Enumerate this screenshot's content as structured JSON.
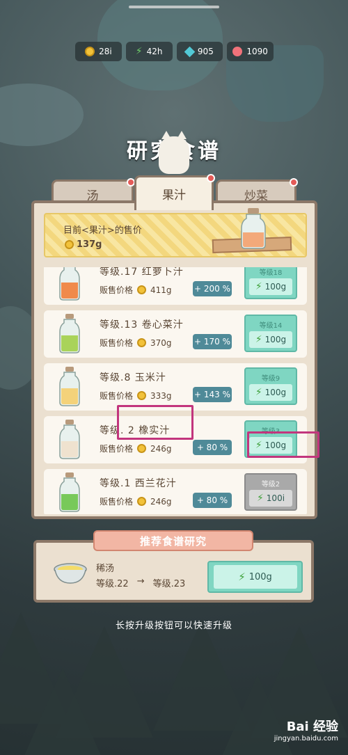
{
  "resources": [
    {
      "icon": "coin-icon",
      "value": "28i"
    },
    {
      "icon": "energy-bolt-icon",
      "value": "42h"
    },
    {
      "icon": "gem-icon",
      "value": "905"
    },
    {
      "icon": "shell-icon",
      "value": "1090"
    }
  ],
  "title": "研究食谱",
  "tabs": [
    {
      "label": "汤",
      "active": false,
      "badge": true
    },
    {
      "label": "果汁",
      "active": true,
      "badge": true
    },
    {
      "label": "炒菜",
      "active": false,
      "badge": true
    }
  ],
  "price_box": {
    "label": "目前<果汁>的售价",
    "value": "137g"
  },
  "recipes": [
    {
      "name": "等级.17  红萝卜汁",
      "sell_label": "贩售价格",
      "price": "411g",
      "bonus": "+ 200 %",
      "next_level": "等级18",
      "cost": "100g",
      "locked": false,
      "juice_color": "#f08a4b"
    },
    {
      "name": "等级.13  卷心菜汁",
      "sell_label": "贩售价格",
      "price": "370g",
      "bonus": "+ 170 %",
      "next_level": "等级14",
      "cost": "100g",
      "locked": false,
      "juice_color": "#a9d35a"
    },
    {
      "name": "等级.8  玉米汁",
      "sell_label": "贩售价格",
      "price": "333g",
      "bonus": "+ 143 %",
      "next_level": "等级9",
      "cost": "100g",
      "locked": false,
      "juice_color": "#f4d27a"
    },
    {
      "name": "等级. 2  橡实汁",
      "sell_label": "贩售价格",
      "price": "246g",
      "bonus": "+ 80 %",
      "next_level": "等级3",
      "cost": "100g",
      "locked": false,
      "juice_color": "#efe2cf"
    },
    {
      "name": "等级.1  西兰花汁",
      "sell_label": "贩售价格",
      "price": "246g",
      "bonus": "+ 80 %",
      "next_level": "等级2",
      "cost": "100i",
      "locked": true,
      "juice_color": "#78c95a"
    }
  ],
  "recommend": {
    "title": "推荐食谱研究",
    "name": "稀汤",
    "from_level": "等级.22",
    "arrow": "→",
    "to_level": "等级.23",
    "cost": "100g"
  },
  "hint": "长按升级按钮可以快速升级",
  "watermark": {
    "brand": "Bai 经验",
    "url": "jingyan.baidu.com"
  },
  "colors": {
    "accent_green": "#7fd6c2",
    "highlight": "#c2357d",
    "panel_border": "#8c7868"
  }
}
